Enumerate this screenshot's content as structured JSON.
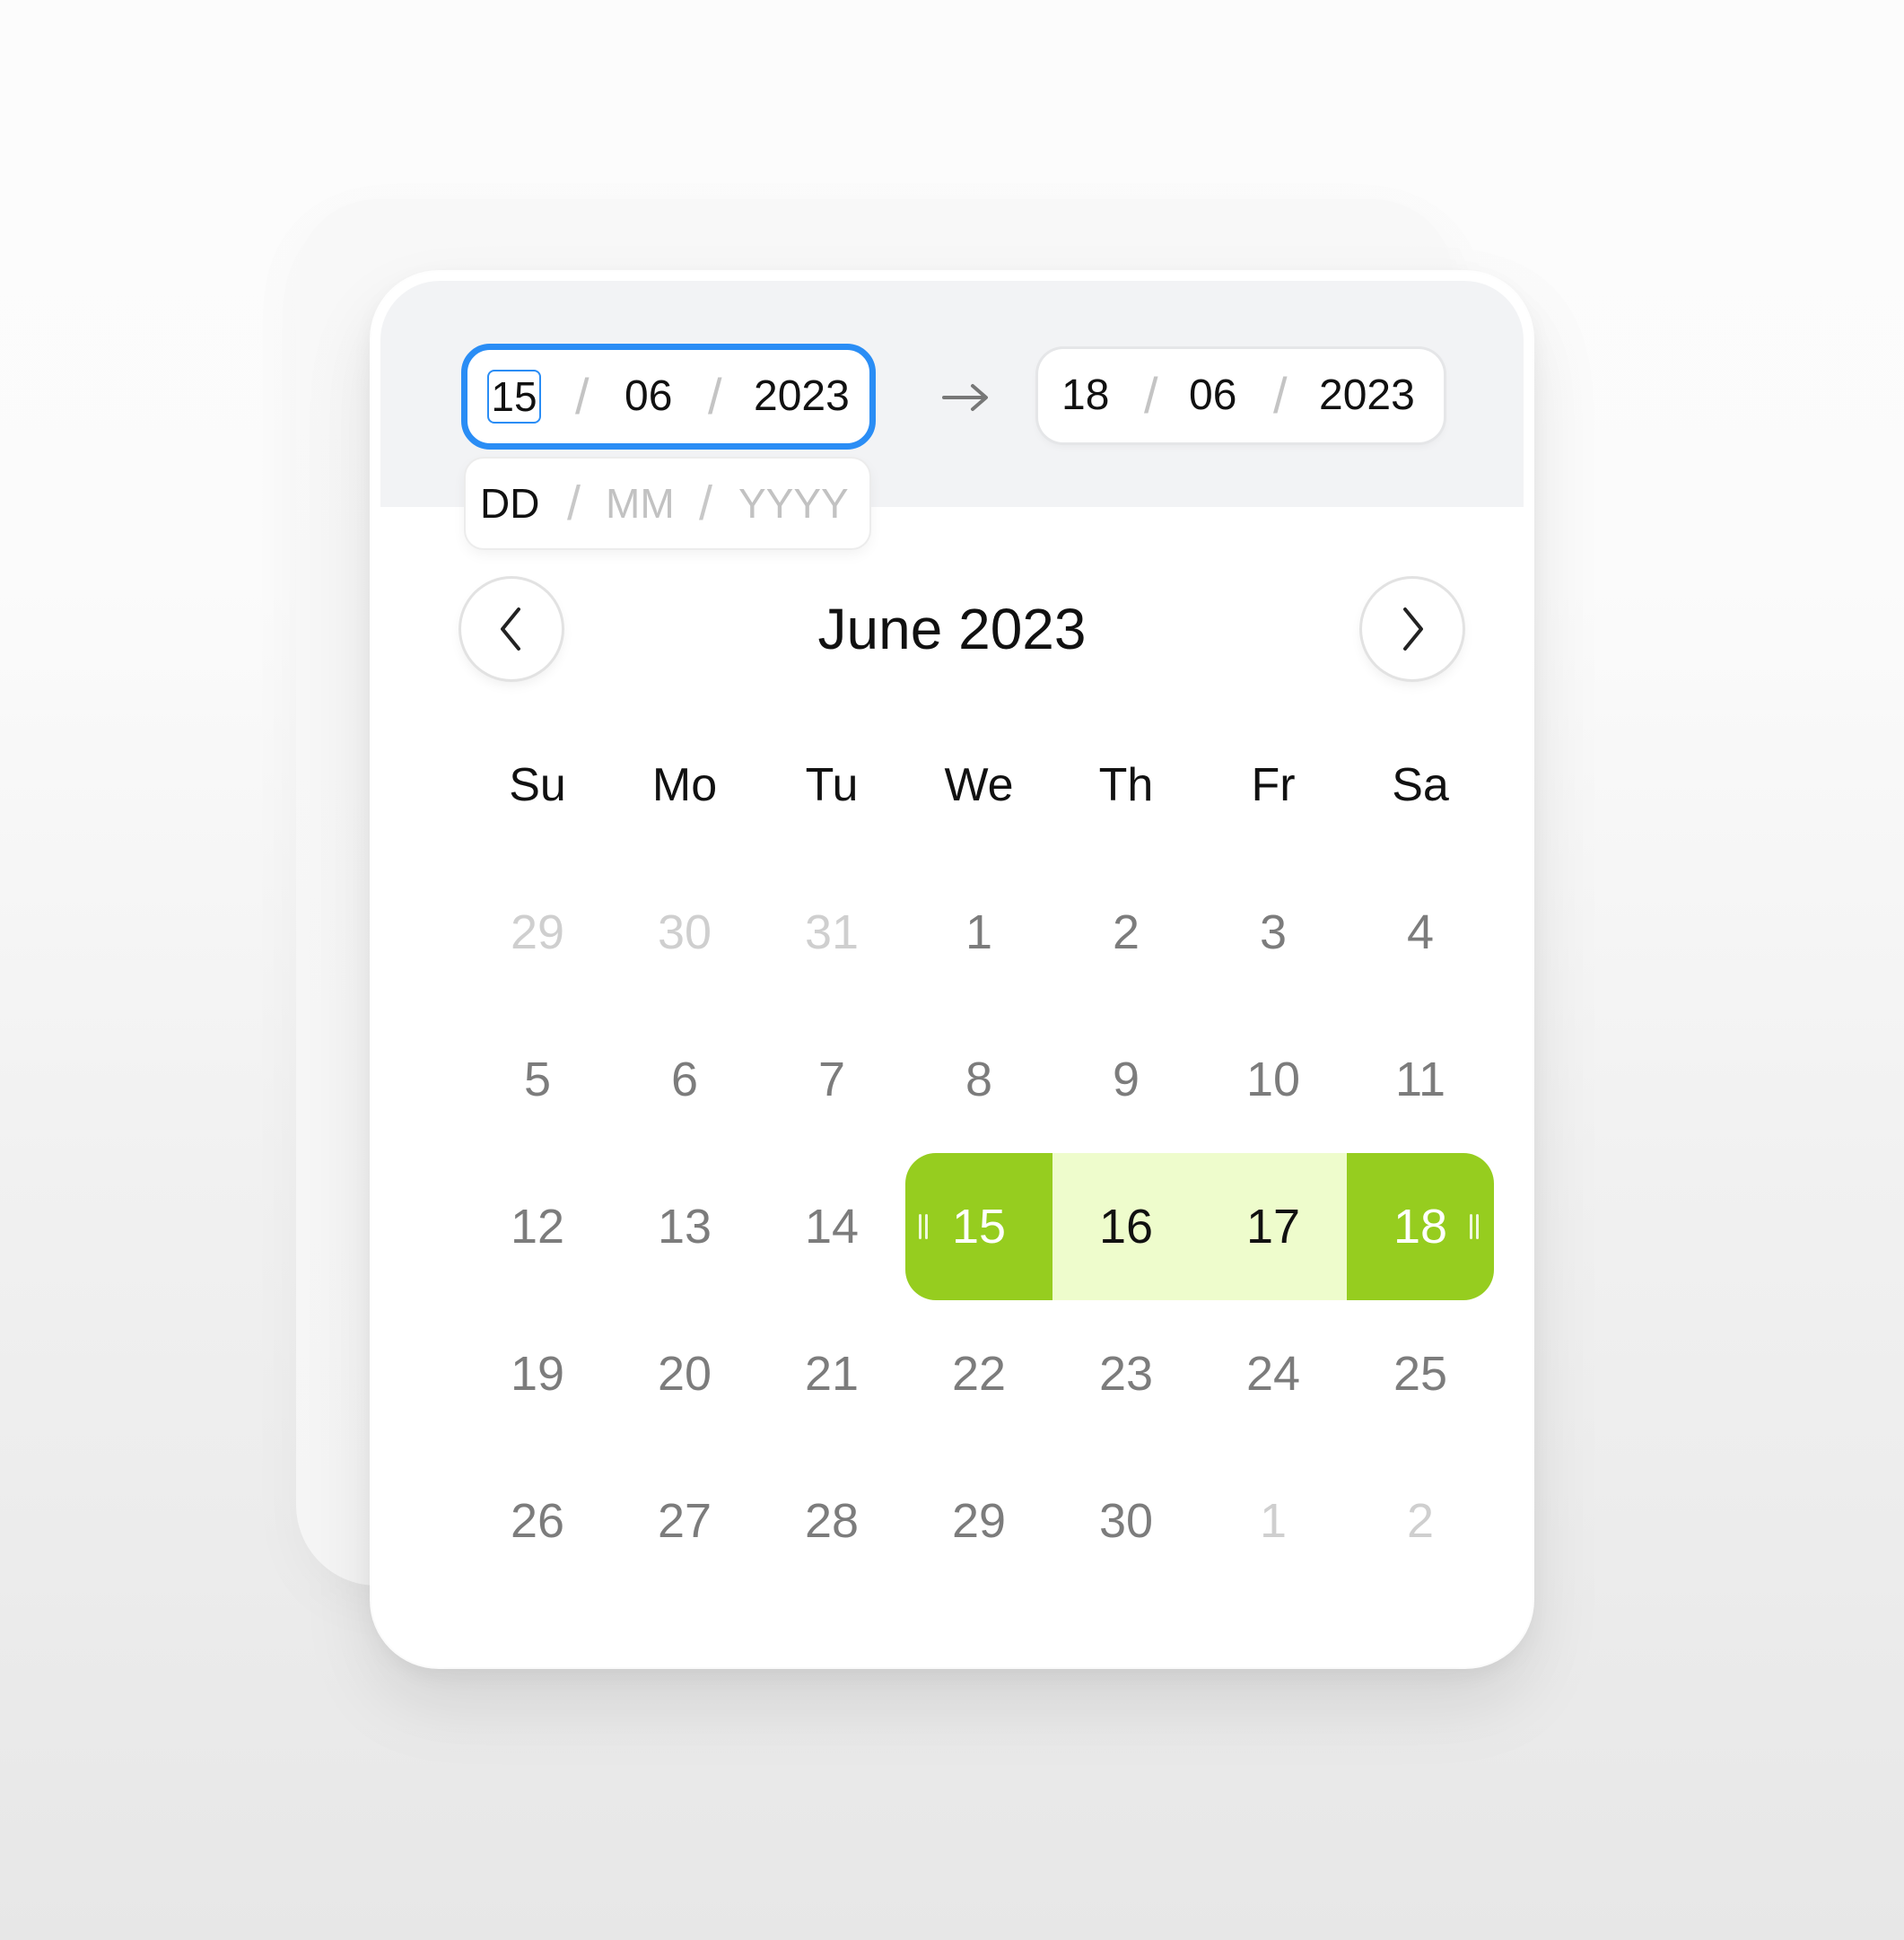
{
  "start_date": {
    "day": "15",
    "month": "06",
    "year": "2023"
  },
  "end_date": {
    "day": "18",
    "month": "06",
    "year": "2023"
  },
  "separator": "/",
  "format_hint": {
    "day": "DD",
    "month": "MM",
    "year": "YYYY"
  },
  "month_title": "June 2023",
  "weekdays": [
    "Su",
    "Mo",
    "Tu",
    "We",
    "Th",
    "Fr",
    "Sa"
  ],
  "weeks": [
    [
      {
        "label": "29",
        "state": "other"
      },
      {
        "label": "30",
        "state": "other"
      },
      {
        "label": "31",
        "state": "other"
      },
      {
        "label": "1",
        "state": "normal"
      },
      {
        "label": "2",
        "state": "normal"
      },
      {
        "label": "3",
        "state": "normal"
      },
      {
        "label": "4",
        "state": "normal"
      }
    ],
    [
      {
        "label": "5",
        "state": "normal"
      },
      {
        "label": "6",
        "state": "normal"
      },
      {
        "label": "7",
        "state": "normal"
      },
      {
        "label": "8",
        "state": "normal"
      },
      {
        "label": "9",
        "state": "normal"
      },
      {
        "label": "10",
        "state": "normal"
      },
      {
        "label": "11",
        "state": "normal"
      }
    ],
    [
      {
        "label": "12",
        "state": "normal"
      },
      {
        "label": "13",
        "state": "normal"
      },
      {
        "label": "14",
        "state": "normal"
      },
      {
        "label": "15",
        "state": "range-start"
      },
      {
        "label": "16",
        "state": "in-range"
      },
      {
        "label": "17",
        "state": "in-range"
      },
      {
        "label": "18",
        "state": "range-end"
      }
    ],
    [
      {
        "label": "19",
        "state": "normal"
      },
      {
        "label": "20",
        "state": "normal"
      },
      {
        "label": "21",
        "state": "normal"
      },
      {
        "label": "22",
        "state": "normal"
      },
      {
        "label": "23",
        "state": "normal"
      },
      {
        "label": "24",
        "state": "normal"
      },
      {
        "label": "25",
        "state": "normal"
      }
    ],
    [
      {
        "label": "26",
        "state": "normal"
      },
      {
        "label": "27",
        "state": "normal"
      },
      {
        "label": "28",
        "state": "normal"
      },
      {
        "label": "29",
        "state": "normal"
      },
      {
        "label": "30",
        "state": "normal"
      },
      {
        "label": "1",
        "state": "other"
      },
      {
        "label": "2",
        "state": "other"
      }
    ]
  ],
  "icons": {
    "prev": "chevron-left-icon",
    "next": "chevron-right-icon",
    "arrow": "arrow-right-icon",
    "handle": "drag-handle-icon"
  },
  "colors": {
    "focus_blue": "#2a8df5",
    "range_endpoint": "#96cd1f",
    "range_fill": "#eefccc",
    "day_text": "#7c7c7c",
    "muted_text": "#cfcfcf"
  }
}
